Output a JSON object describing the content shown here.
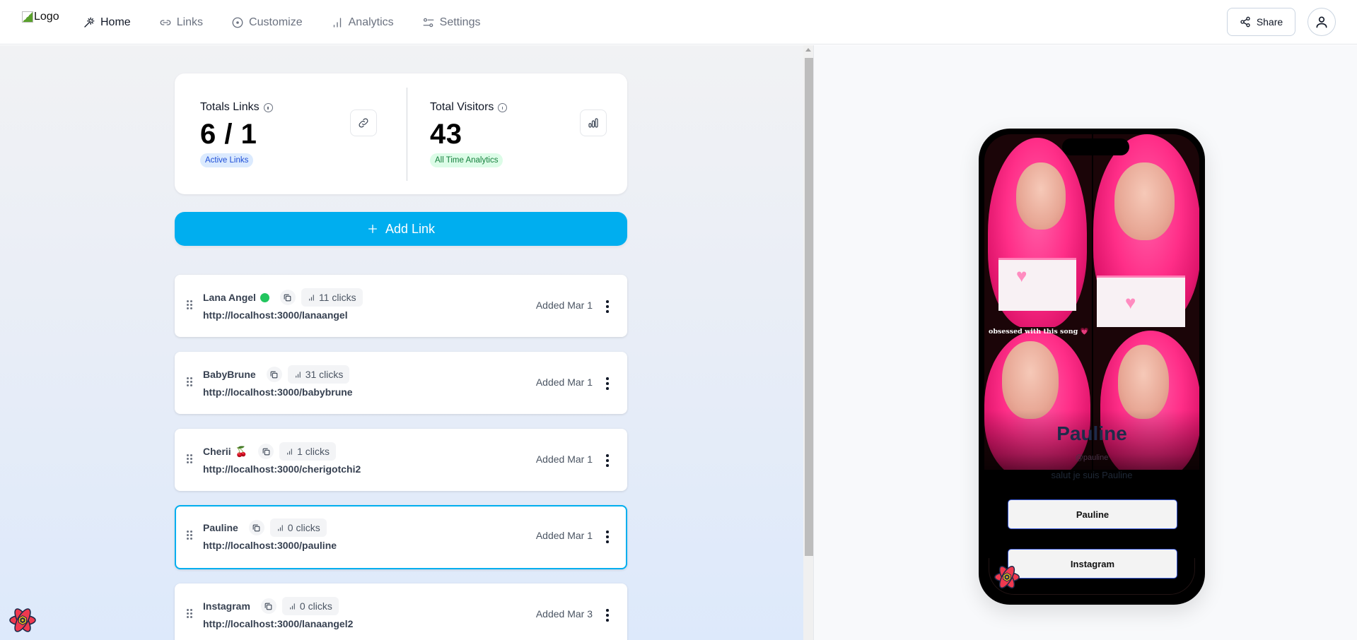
{
  "header": {
    "logo_alt": "Logo",
    "nav": [
      {
        "label": "Home",
        "icon": "magic-wand-icon",
        "active": true
      },
      {
        "label": "Links",
        "icon": "link-icon",
        "active": false
      },
      {
        "label": "Customize",
        "icon": "target-icon",
        "active": false
      },
      {
        "label": "Analytics",
        "icon": "bar-chart-icon",
        "active": false
      },
      {
        "label": "Settings",
        "icon": "sliders-icon",
        "active": false
      }
    ],
    "share_label": "Share",
    "share_icon": "share-icon",
    "user_icon": "user-icon"
  },
  "stats": {
    "links": {
      "label": "Totals Links",
      "value": "6 / 1",
      "badge": "Active Links",
      "icon": "link-icon"
    },
    "visitors": {
      "label": "Total Visitors",
      "value": "43",
      "badge": "All Time Analytics",
      "icon": "bar-chart-icon"
    }
  },
  "add_link_label": "Add Link",
  "links": [
    {
      "name": "Lana Angel",
      "status": "active",
      "clicks": "11 clicks",
      "url": "http://localhost:3000/lanaangel",
      "date": "Added Mar 1",
      "selected": false
    },
    {
      "name": "BabyBrune",
      "status": "",
      "clicks": "31 clicks",
      "url": "http://localhost:3000/babybrune",
      "date": "Added Mar 1",
      "selected": false
    },
    {
      "name": "Cherii",
      "emoji": "🍒",
      "clicks": "1 clicks",
      "url": "http://localhost:3000/cherigotchi2",
      "date": "Added Mar 1",
      "selected": false
    },
    {
      "name": "Pauline",
      "status": "",
      "clicks": "0 clicks",
      "url": "http://localhost:3000/pauline",
      "date": "Added Mar 1",
      "selected": true
    },
    {
      "name": "Instagram",
      "status": "",
      "clicks": "0 clicks",
      "url": "http://localhost:3000/lanaangel2",
      "date": "Added Mar 3",
      "selected": false
    }
  ],
  "preview": {
    "caption": "obsessed with this song 💗",
    "name": "Pauline",
    "handle": "@pauline",
    "bio": "salut je suis Pauline",
    "buttons": [
      "Pauline",
      "Instagram"
    ]
  },
  "colors": {
    "accent": "#00aeef",
    "active_dot": "#22c55e",
    "badge_blue_bg": "#dbeafe",
    "badge_green_bg": "#dcfce7"
  }
}
